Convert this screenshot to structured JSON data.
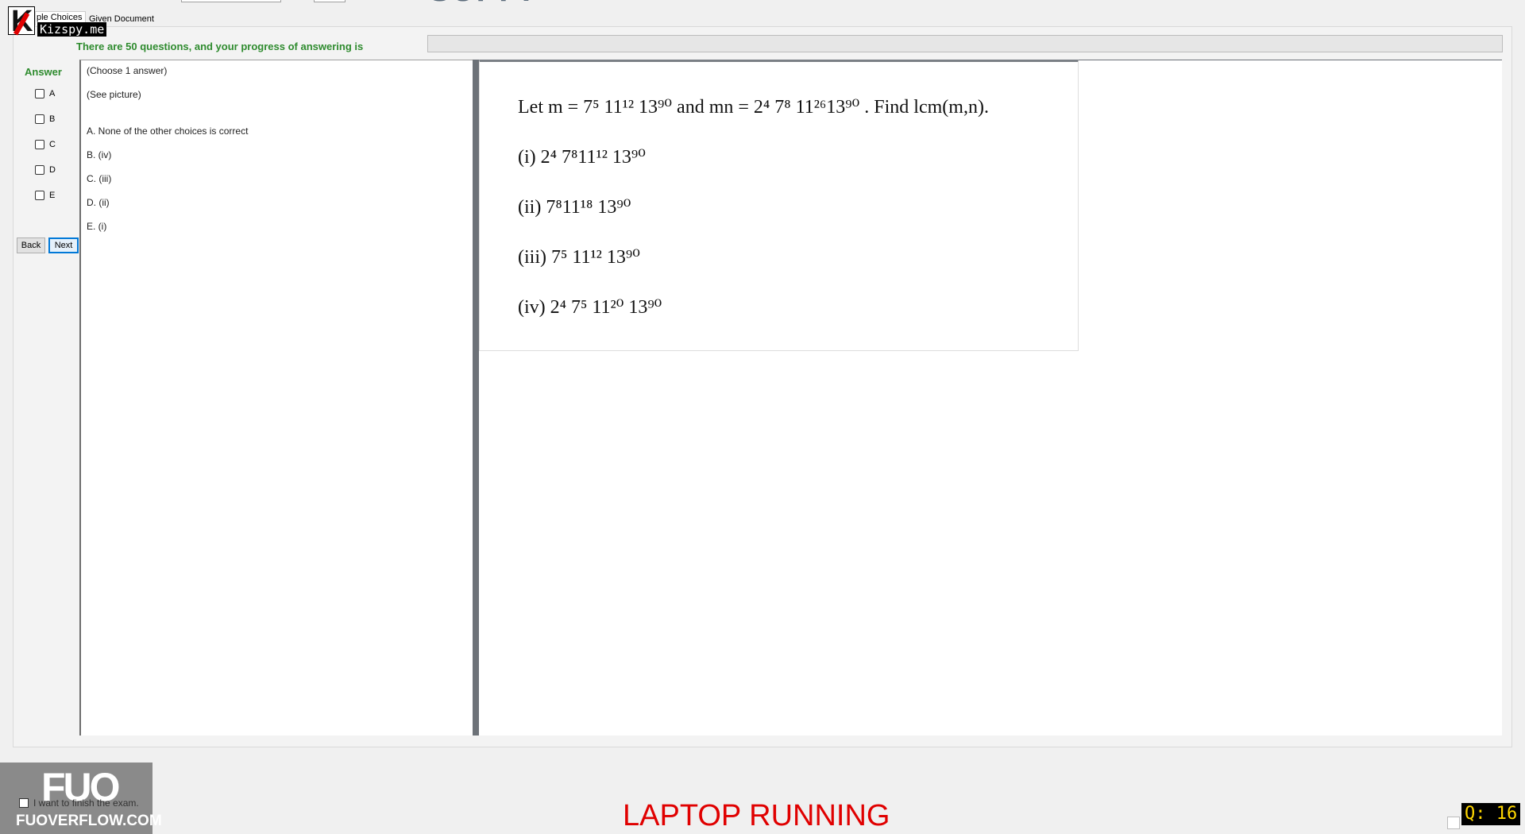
{
  "tabs": {
    "multiple_choices": "ple Choices",
    "given_document": "Given Document"
  },
  "logo": {
    "text": "Kizspy.me",
    "letter": "K"
  },
  "header": {
    "progress_text": "There are 50 questions, and your progress of answering is",
    "progress_percent": 0
  },
  "answer": {
    "label": "Answer",
    "options": [
      "A",
      "B",
      "C",
      "D",
      "E"
    ]
  },
  "nav": {
    "back": "Back",
    "next": "Next"
  },
  "question": {
    "choose": "(Choose 1 answer)",
    "see_picture": "(See picture)",
    "choices": [
      "A.  None of the other choices is correct",
      "B.  (iv)",
      "C.  (iii)",
      "D.  (ii)",
      "E.  (i)"
    ]
  },
  "document": {
    "line1": "Let m = 7⁵ 11¹² 13⁹⁰ and mn = 2⁴ 7⁸ 11²⁶13⁹⁰ . Find lcm(m,n).",
    "line_i": "(i) 2⁴ 7⁸11¹² 13⁹⁰",
    "line_ii": "(ii) 7⁸11¹⁸ 13⁹⁰",
    "line_iii": "(iii) 7⁵ 11¹² 13⁹⁰",
    "line_iv": "(iv) 2⁴ 7⁵ 11²⁰ 13⁹⁰"
  },
  "footer": {
    "finish_label": "I want to finish the exam.",
    "status": "LAPTOP RUNNING",
    "question_badge": "Q: 16",
    "watermark_big": "FUO",
    "watermark_small": "FUOVERFLOW.COM"
  }
}
